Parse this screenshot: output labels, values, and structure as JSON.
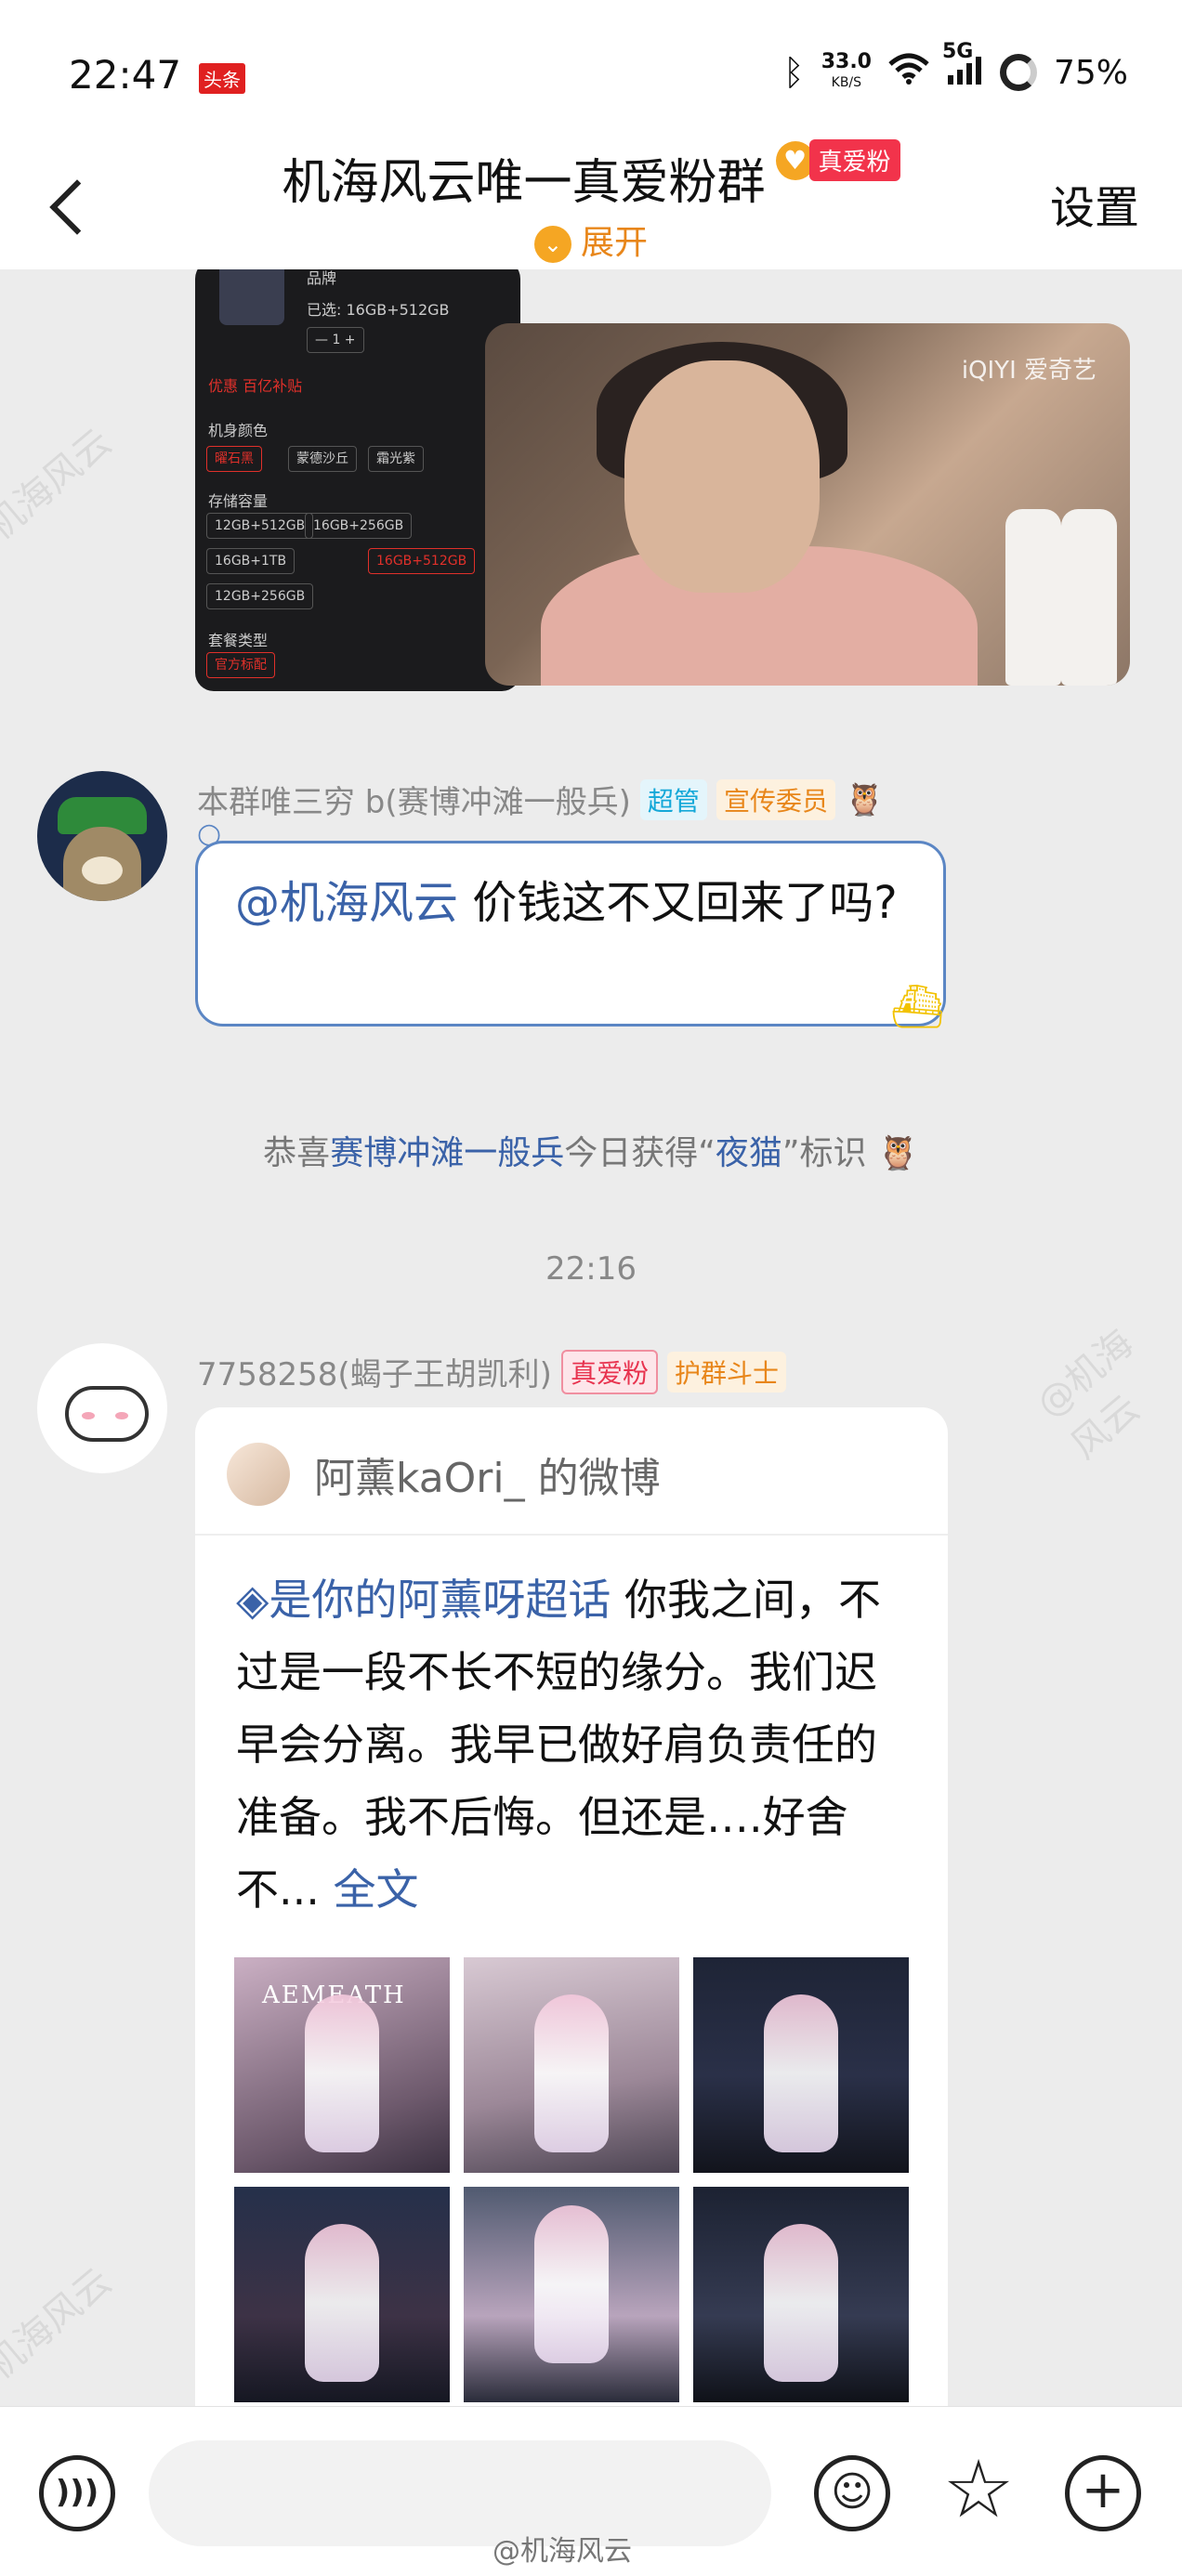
{
  "status_bar": {
    "time": "22:47",
    "app_badge": "头条",
    "net_speed": "33.0",
    "net_unit": "KB/S",
    "network": "5G",
    "battery": "75%"
  },
  "header": {
    "title": "机海风云唯一真爱粉群",
    "fan_badge": "真爱粉",
    "expand_label": "展开",
    "settings_label": "设置"
  },
  "shared_images": {
    "video_logo": "iQIYI 爱奇艺"
  },
  "message1": {
    "sender": "本群唯三穷 b(赛博冲滩一般兵)",
    "tags": [
      "超管",
      "宣传委员"
    ],
    "mention": "@机海风云",
    "text": " 价钱这不又回来了吗?"
  },
  "system_message": {
    "prefix": "恭喜",
    "user": "赛博冲滩一般兵",
    "middle": "今日获得“",
    "badge": "夜猫",
    "suffix": "”标识"
  },
  "timestamp": "22:16",
  "message2": {
    "sender": "7758258(蝎子王胡凯利)",
    "tags": [
      "真爱粉",
      "护群斗士"
    ],
    "card": {
      "source": "阿薰kaOri_ 的微博",
      "topic": "是你的阿薰呀超话",
      "text": "  你我之间，不过是一段不长不短的缘分。我们迟早会分离。我早已做好肩负责任的准备。我不后悔。但还是….好舍不...",
      "more": " 全文",
      "image_label": "AEMEATH"
    }
  },
  "toolbar": {
    "input_placeholder": "",
    "watermark": "@机海风云"
  },
  "watermarks": [
    "@机海风云",
    "机海风云",
    "机海风云"
  ]
}
